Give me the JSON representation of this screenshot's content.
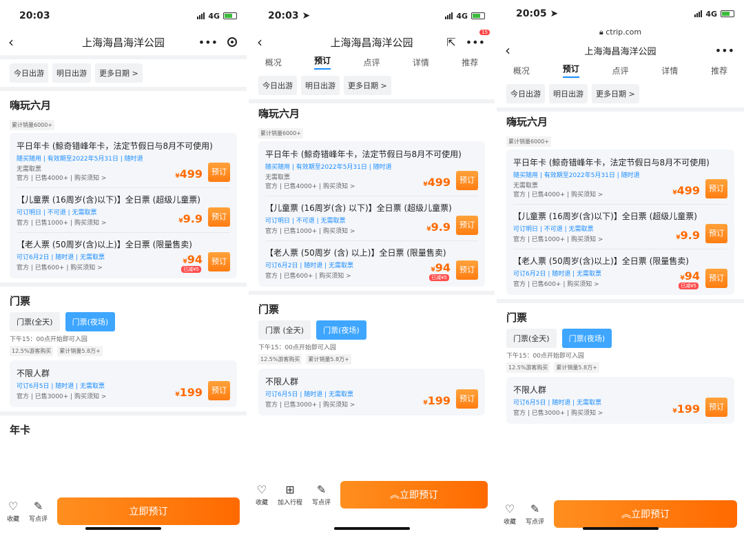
{
  "phones": [
    {
      "time": "20:03",
      "network": "4G",
      "title": "上海海昌海洋公园",
      "date_buttons": [
        "今日出游",
        "明日出游",
        "更多日期 >"
      ],
      "promo_title": "嗨玩六月",
      "promo_sales": "累计销量6000+",
      "products": [
        {
          "name": "平日年卡 (鲸奇错峰年卡，法定节假日与8月不可使用)",
          "tags": "随买随用 | 有效期至2022年5月31日 | 随时退",
          "tags2": "无需取票",
          "meta": "官方 | 已售4000+ | 购买须知 >",
          "price": "499",
          "book": "预订"
        },
        {
          "name": "【儿童票 (16周岁(含)以下)】全日票 (超级儿童票)",
          "tags": "可订明日 | 不可退 | 无需取票",
          "meta": "官方 | 已售1000+ | 购买须知 >",
          "price": "9.9",
          "book": "预订"
        },
        {
          "name": "【老人票 (50周岁(含)以上)】全日票 (限量售卖)",
          "tags": "可订6月2日 | 随时退 | 无需取票",
          "meta": "官方 | 已售600+ | 购买须知 >",
          "price": "94",
          "discount": "已减¥5",
          "book": "预订"
        }
      ],
      "ticket_title": "门票",
      "ticket_tabs": [
        "门票(全天)",
        "门票(夜场)"
      ],
      "ticket_note": "下午15：00点开始即可入园",
      "chips": [
        "12.5%游客购买",
        "累计销量5.8万+"
      ],
      "ticket": {
        "name": "不限人群",
        "tags": "可订6月5日 | 随时退 | 无需取票",
        "meta": "官方 | 已售3000+ | 购买须知 >",
        "price": "199",
        "book": "预订"
      },
      "next_section": "年卡",
      "footer": {
        "fav": "收藏",
        "review": "写点评",
        "cta": "立即预订"
      }
    },
    {
      "time": "20:03",
      "network": "4G",
      "title": "上海海昌海洋公园",
      "badge": "15",
      "tabs": [
        "概况",
        "预订",
        "点评",
        "详情",
        "推荐"
      ],
      "date_buttons": [
        "今日出游",
        "明日出游",
        "更多日期 >"
      ],
      "promo_title": "嗨玩六月",
      "promo_sales": "累计销量6000+",
      "products": [
        {
          "name": "平日年卡 (鲸奇错峰年卡，法定节假日与8月不可使用)",
          "tags": "随买随用 | 有效期至2022年5月31日 | 随时退",
          "tags2": "无需取票",
          "meta": "官方 | 已售4000+ | 购买须知 >",
          "price": "499",
          "book": "预订"
        },
        {
          "name": "【儿童票 (16周岁(含) 以下)】全日票 (超级儿童票)",
          "tags": "可订明日 | 不可退 | 无需取票",
          "meta": "官方 | 已售1000+ | 购买须知 >",
          "price": "9.9",
          "book": "预订"
        },
        {
          "name": "【老人票 (50周岁 (含) 以上)】全日票 (限量售卖)",
          "tags": "可订6月2日 | 随时退 | 无需取票",
          "meta": "官方 | 已售600+ | 购买须知 >",
          "price": "94",
          "discount": "已减¥5",
          "book": "预订"
        }
      ],
      "ticket_title": "门票",
      "ticket_tabs": [
        "门票 (全天)",
        "门票(夜场)"
      ],
      "ticket_note": "下午15：00点开始即可入园",
      "chips": [
        "12.5%游客购买",
        "累计销量5.8万+"
      ],
      "ticket": {
        "name": "不限人群",
        "tags": "可订6月5日 | 随时退 | 无需取票",
        "meta": "官方 | 已售3000+ | 购买须知 >",
        "price": "199",
        "book": "预订"
      },
      "footer": {
        "fav": "收藏",
        "trip": "加入行程",
        "review": "写点评",
        "cta": "立即预订"
      }
    },
    {
      "time": "20:05",
      "network": "4G",
      "url": "ctrip.com",
      "title": "上海海昌海洋公园",
      "tabs": [
        "概况",
        "预订",
        "点评",
        "详情",
        "推荐"
      ],
      "date_buttons": [
        "今日出游",
        "明日出游",
        "更多日期 >"
      ],
      "promo_title": "嗨玩六月",
      "promo_sales": "累计销量6000+",
      "products": [
        {
          "name": "平日年卡 (鲸奇错峰年卡，法定节假日与8月不可使用)",
          "tags": "随买随用 | 有效期至2022年5月31日 | 随时退",
          "tags2": "无需取票",
          "meta": "官方 | 已售4000+ | 购买须知 >",
          "price": "499",
          "book": "预订"
        },
        {
          "name": "【儿童票 (16周岁(含)以下)】全日票 (超级儿童票)",
          "tags": "可订明日 | 不可退 | 无需取票",
          "meta": "官方 | 已售1000+ | 购买须知 >",
          "price": "9.9",
          "book": "预订"
        },
        {
          "name": "【老人票 (50周岁(含)以上)】全日票 (限量售卖)",
          "tags": "可订6月2日 | 随时退 | 无需取票",
          "meta": "官方 | 已售600+ | 购买须知 >",
          "price": "94",
          "discount": "已减¥5",
          "book": "预订"
        }
      ],
      "ticket_title": "门票",
      "ticket_tabs": [
        "门票(全天)",
        "门票(夜场)"
      ],
      "ticket_note": "下午15：00点开始即可入园",
      "chips": [
        "12.5%游客购买",
        "累计销量5.8万+"
      ],
      "ticket": {
        "name": "不限人群",
        "tags": "可订6月5日 | 随时退 | 无需取票",
        "meta": "官方 | 已售3000+ | 购买须知 >",
        "price": "199",
        "book": "预订"
      },
      "footer": {
        "fav": "收藏",
        "review": "写点评",
        "cta": "立即预订"
      }
    }
  ]
}
